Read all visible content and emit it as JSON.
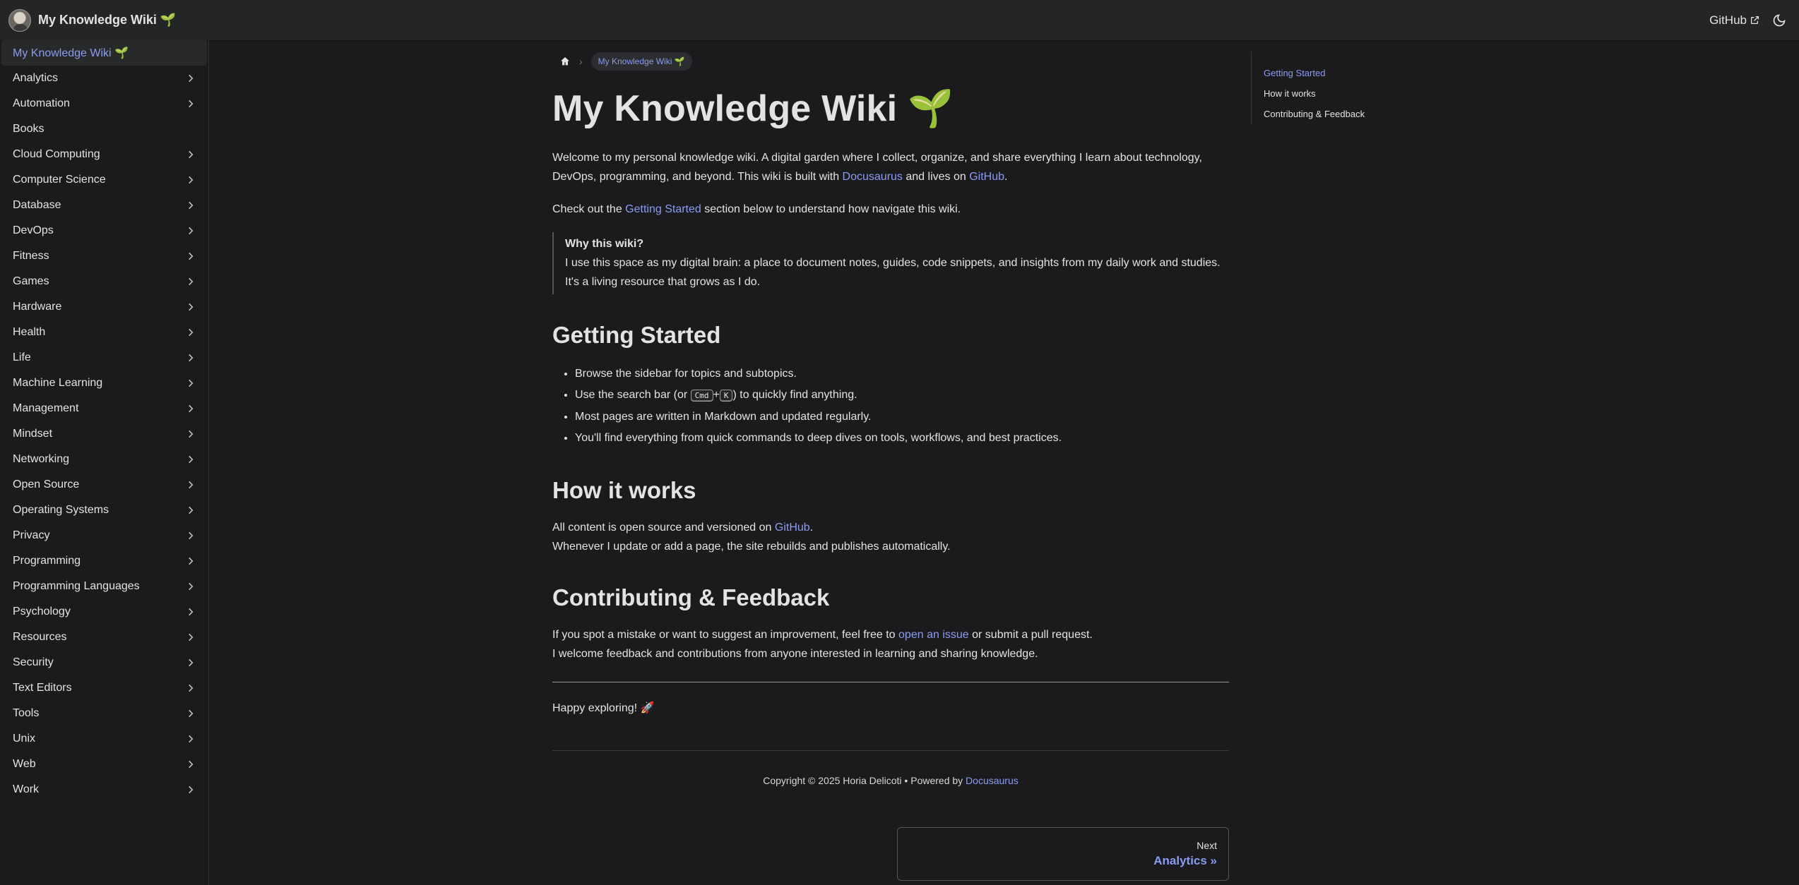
{
  "navbar": {
    "title": "My Knowledge Wiki 🌱",
    "github_label": "GitHub"
  },
  "sidebar": {
    "items": [
      {
        "label": "My Knowledge Wiki 🌱",
        "active": true,
        "expandable": false
      },
      {
        "label": "Analytics",
        "expandable": true
      },
      {
        "label": "Automation",
        "expandable": true
      },
      {
        "label": "Books",
        "expandable": false
      },
      {
        "label": "Cloud Computing",
        "expandable": true
      },
      {
        "label": "Computer Science",
        "expandable": true
      },
      {
        "label": "Database",
        "expandable": true
      },
      {
        "label": "DevOps",
        "expandable": true
      },
      {
        "label": "Fitness",
        "expandable": true
      },
      {
        "label": "Games",
        "expandable": true
      },
      {
        "label": "Hardware",
        "expandable": true
      },
      {
        "label": "Health",
        "expandable": true
      },
      {
        "label": "Life",
        "expandable": true
      },
      {
        "label": "Machine Learning",
        "expandable": true
      },
      {
        "label": "Management",
        "expandable": true
      },
      {
        "label": "Mindset",
        "expandable": true
      },
      {
        "label": "Networking",
        "expandable": true
      },
      {
        "label": "Open Source",
        "expandable": true
      },
      {
        "label": "Operating Systems",
        "expandable": true
      },
      {
        "label": "Privacy",
        "expandable": true
      },
      {
        "label": "Programming",
        "expandable": true
      },
      {
        "label": "Programming Languages",
        "expandable": true
      },
      {
        "label": "Psychology",
        "expandable": true
      },
      {
        "label": "Resources",
        "expandable": true
      },
      {
        "label": "Security",
        "expandable": true
      },
      {
        "label": "Text Editors",
        "expandable": true
      },
      {
        "label": "Tools",
        "expandable": true
      },
      {
        "label": "Unix",
        "expandable": true
      },
      {
        "label": "Web",
        "expandable": true
      },
      {
        "label": "Work",
        "expandable": true
      }
    ]
  },
  "breadcrumb": {
    "current": "My Knowledge Wiki 🌱"
  },
  "main": {
    "title": "My Knowledge Wiki 🌱",
    "intro": {
      "text1": "Welcome to my personal knowledge wiki. A digital garden where I collect, organize, and share everything I learn about technology, DevOps, programming, and beyond. This wiki is built with ",
      "link1": "Docusaurus",
      "text2": " and lives on ",
      "link2": "GitHub",
      "text3": "."
    },
    "checkout": {
      "text1": "Check out the ",
      "link": "Getting Started",
      "text2": " section below to understand how navigate this wiki."
    },
    "quote": {
      "title": "Why this wiki?",
      "body": "I use this space as my digital brain: a place to document notes, guides, code snippets, and insights from my daily work and studies. It's a living resource that grows as I do."
    },
    "getting_started": {
      "heading": "Getting Started",
      "item1": "Browse the sidebar for topics and subtopics.",
      "item2_pre": "Use the search bar (or ",
      "kbd1": "Cmd",
      "plus": "+",
      "kbd2": "K",
      "item2_post": ") to quickly find anything.",
      "item3": "Most pages are written in Markdown and updated regularly.",
      "item4": "You'll find everything from quick commands to deep dives on tools, workflows, and best practices."
    },
    "how_it_works": {
      "heading": "How it works",
      "line1_pre": "All content is open source and versioned on ",
      "line1_link": "GitHub",
      "line1_post": ".",
      "line2": "Whenever I update or add a page, the site rebuilds and publishes automatically."
    },
    "contributing": {
      "heading": "Contributing & Feedback",
      "line1_pre": "If you spot a mistake or want to suggest an improvement, feel free to ",
      "line1_link": "open an issue",
      "line1_post": " or submit a pull request.",
      "line2": "I welcome feedback and contributions from anyone interested in learning and sharing knowledge."
    },
    "happy": "Happy exploring! 🚀",
    "footer": {
      "copyright_pre": "Copyright © 2025 Horia Delicoti • Powered by ",
      "copyright_link": "Docusaurus"
    },
    "pager": {
      "sublabel": "Next",
      "label": "Analytics »"
    }
  },
  "toc": {
    "items": [
      {
        "label": "Getting Started",
        "active": true
      },
      {
        "label": "How it works",
        "active": false
      },
      {
        "label": "Contributing & Feedback",
        "active": false
      }
    ]
  },
  "colors": {
    "background": "#1b1b1d",
    "navbar": "#242526",
    "link": "#8a9cf0",
    "text": "#e3e3e3"
  }
}
